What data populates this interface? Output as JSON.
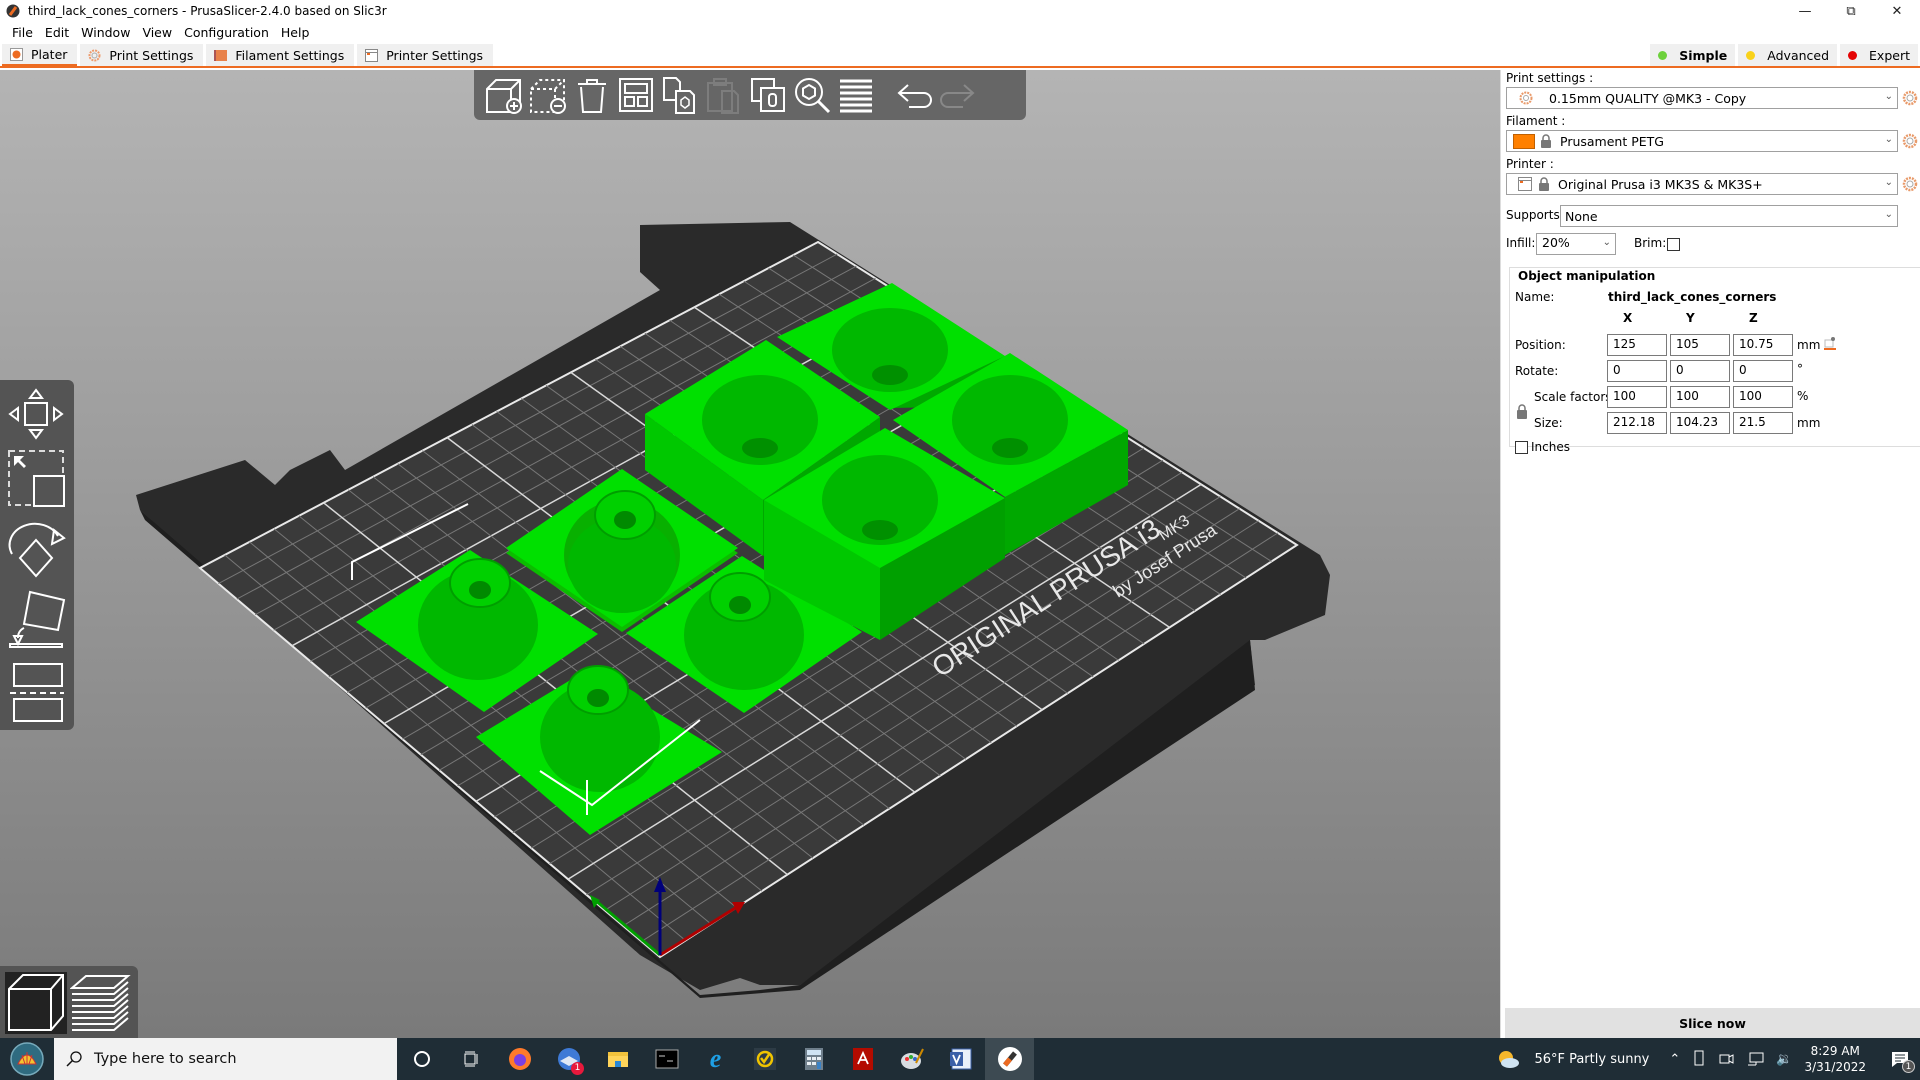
{
  "window": {
    "title": "third_lack_cones_corners - PrusaSlicer-2.4.0 based on Slic3r",
    "controls": [
      "minimize",
      "restore",
      "close"
    ]
  },
  "menu": [
    "File",
    "Edit",
    "Window",
    "View",
    "Configuration",
    "Help"
  ],
  "tabs": [
    {
      "label": "Plater",
      "icon": "plater-icon",
      "active": true
    },
    {
      "label": "Print Settings",
      "icon": "gear-icon"
    },
    {
      "label": "Filament Settings",
      "icon": "spool-icon"
    },
    {
      "label": "Printer Settings",
      "icon": "printer-icon"
    }
  ],
  "modes": [
    {
      "label": "Simple",
      "color": "#6dd13c",
      "active": true
    },
    {
      "label": "Advanced",
      "color": "#f9d21a"
    },
    {
      "label": "Expert",
      "color": "#e40404"
    }
  ],
  "toolbar": {
    "top": [
      "add-object",
      "delete-object",
      "delete-all",
      "arrange",
      "copy",
      "paste",
      "add-instance",
      "search",
      "layers-editing",
      "undo",
      "redo"
    ],
    "left": [
      "move",
      "scale",
      "rotate",
      "place-on-face",
      "cut"
    ],
    "view": [
      "3d-view",
      "preview"
    ]
  },
  "bed": {
    "label_main": "ORIGINAL PRUSA i3",
    "label_model": "MK3",
    "label_by": "by Josef Prusa"
  },
  "sidebar": {
    "print_settings_label": "Print settings :",
    "print_settings_value": "0.15mm QUALITY @MK3 - Copy",
    "filament_label": "Filament :",
    "filament_value": "Prusament PETG",
    "filament_color": "#ff8000",
    "printer_label": "Printer :",
    "printer_value": "Original Prusa i3 MK3S & MK3S+",
    "supports_label": "Supports:",
    "supports_value": "None",
    "infill_label": "Infill:",
    "infill_value": "20%",
    "brim_label": "Brim:",
    "brim_checked": false
  },
  "object_manipulation": {
    "title": "Object manipulation",
    "name_label": "Name:",
    "name_value": "third_lack_cones_corners",
    "axes": [
      "X",
      "Y",
      "Z"
    ],
    "rows": [
      {
        "label": "Position:",
        "values": [
          "125",
          "105",
          "10.75"
        ],
        "unit": "mm"
      },
      {
        "label": "Rotate:",
        "values": [
          "0",
          "0",
          "0"
        ],
        "unit": "°"
      },
      {
        "label": "Scale factors:",
        "values": [
          "100",
          "100",
          "100"
        ],
        "unit": "%"
      },
      {
        "label": "Size:",
        "values": [
          "212.18",
          "104.23",
          "21.5"
        ],
        "unit": "mm"
      }
    ],
    "inches_label": "Inches",
    "inches_checked": false
  },
  "slice_button": "Slice now",
  "taskbar": {
    "search_placeholder": "Type here to search",
    "apps": [
      "cortana",
      "task-view",
      "firefox",
      "thunderbird",
      "file-explorer",
      "terminal",
      "internet-explorer",
      "norton",
      "calculator",
      "acrobat",
      "paint",
      "visio",
      "prusaslicer"
    ],
    "thunderbird_badge": "1",
    "weather": "56°F  Partly sunny",
    "time": "8:29 AM",
    "date": "3/31/2022",
    "notifications_badge": "1"
  }
}
